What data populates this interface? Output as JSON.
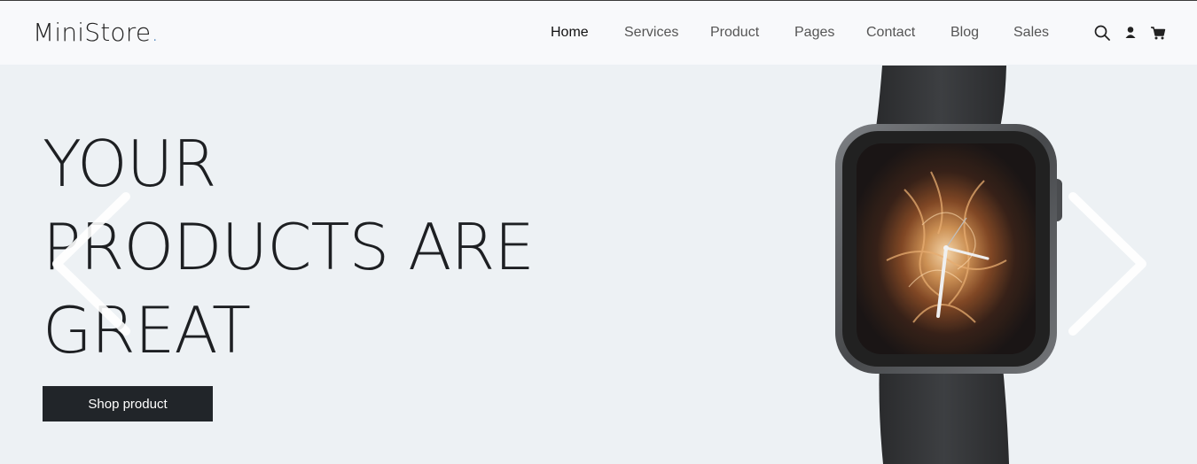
{
  "brand": {
    "name": "MiniStore",
    "dot": "."
  },
  "nav": {
    "items": [
      {
        "label": "Home",
        "active": true
      },
      {
        "label": "Services",
        "active": false
      },
      {
        "label": "Product",
        "active": false
      },
      {
        "label": "Pages",
        "active": false
      },
      {
        "label": "Contact",
        "active": false
      },
      {
        "label": "Blog",
        "active": false
      },
      {
        "label": "Sales",
        "active": false
      }
    ]
  },
  "header_icons": [
    "search-icon",
    "user-icon",
    "cart-icon"
  ],
  "hero": {
    "headline_lines": [
      "YOUR",
      "PRODUCTS ARE",
      "GREAT"
    ],
    "cta_label": "Shop product",
    "image": "smartwatch"
  },
  "colors": {
    "accent_dot": "#5b8fc2",
    "hero_bg": "#edf1f4",
    "header_bg": "#f8f9fb",
    "button_bg": "#212529"
  }
}
